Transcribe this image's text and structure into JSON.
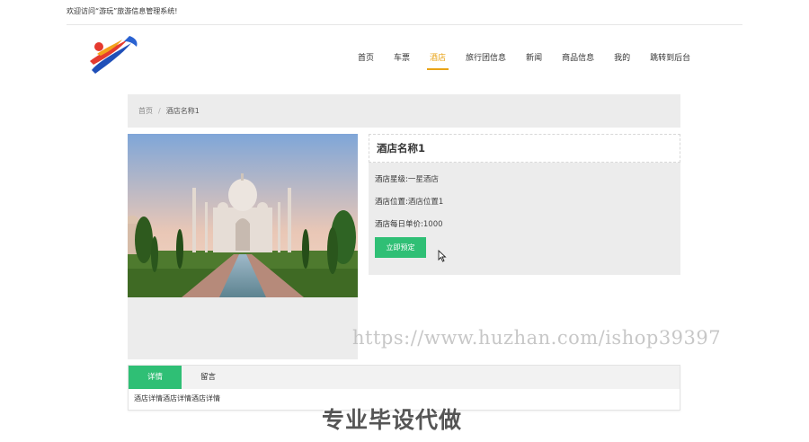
{
  "header": {
    "welcome": "欢迎访问“游玩”旅游信息管理系统!"
  },
  "nav": {
    "items": [
      {
        "label": "首页"
      },
      {
        "label": "车票"
      },
      {
        "label": "酒店"
      },
      {
        "label": "旅行团信息"
      },
      {
        "label": "新闻"
      },
      {
        "label": "商品信息"
      },
      {
        "label": "我的"
      },
      {
        "label": "跳转到后台"
      }
    ],
    "active_color": "#e8a317"
  },
  "breadcrumb": {
    "home": "首页",
    "separator": "/",
    "current": "酒店名称1"
  },
  "hotel": {
    "title": "酒店名称1",
    "star_label": "酒店星级:",
    "star_value": "一星酒店",
    "location_label": "酒店位置:",
    "location_value": "酒店位置1",
    "price_label": "酒店每日单价:",
    "price_value": "1000",
    "book_label": "立即预定"
  },
  "tabs": {
    "items": [
      {
        "label": "详情"
      },
      {
        "label": "留言"
      }
    ],
    "content": "酒店详情酒店详情酒店详情"
  },
  "watermark": {
    "url": "https://www.huzhan.com/ishop39397",
    "slogan": "专业毕设代做"
  },
  "colors": {
    "accent": "#2fbf75",
    "nav_active": "#e8a317",
    "panel": "#ececec"
  },
  "icons": {
    "logo": "brand-logo-icon",
    "cursor": "mouse-cursor-icon"
  }
}
